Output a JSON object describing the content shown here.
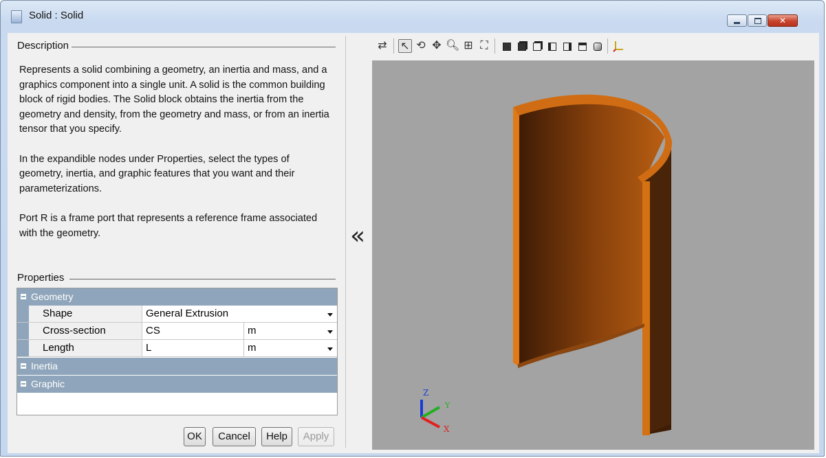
{
  "window": {
    "title": "Solid : Solid"
  },
  "description": {
    "label": "Description",
    "paragraphs": [
      "Represents a solid combining a geometry, an inertia and mass, and a graphics component into a single unit. A solid is the common building block of rigid bodies. The Solid block obtains the inertia from the geometry and density, from the geometry and mass, or from an inertia tensor that you specify.",
      "In the expandible nodes under Properties, select the types of geometry, inertia, and graphic features that you want and their parameterizations.",
      "Port R is a frame port that represents a reference frame associated with the geometry."
    ]
  },
  "properties": {
    "label": "Properties",
    "geometry": {
      "label": "Geometry",
      "rows": [
        {
          "name": "Shape",
          "value": "General Extrusion",
          "unit": ""
        },
        {
          "name": "Cross-section",
          "value": "CS",
          "unit": "m"
        },
        {
          "name": "Length",
          "value": "L",
          "unit": "m"
        }
      ]
    },
    "inertia": {
      "label": "Inertia"
    },
    "graphic": {
      "label": "Graphic"
    }
  },
  "buttons": {
    "ok": "OK",
    "cancel": "Cancel",
    "help": "Help",
    "apply": "Apply"
  },
  "splitter": {
    "collapse_glyph": "«"
  },
  "viewer": {
    "toolbar": [
      "swap-icon",
      "select-icon",
      "rotate-icon",
      "pan-icon",
      "zoom-icon",
      "zoom-box-icon",
      "fit-view-icon",
      "front-view-icon",
      "back-view-icon",
      "left-view-icon",
      "right-view-icon",
      "top-view-icon",
      "bottom-view-icon",
      "isometric-view-icon",
      "axes-icon"
    ],
    "axes": {
      "z": "Z",
      "y": "Y",
      "x": "X"
    },
    "colors": {
      "background": "#a3a3a3",
      "solid": "#c6670f",
      "axis_x": "#e02020",
      "axis_y": "#20b020",
      "axis_z": "#1a3ad8"
    }
  }
}
